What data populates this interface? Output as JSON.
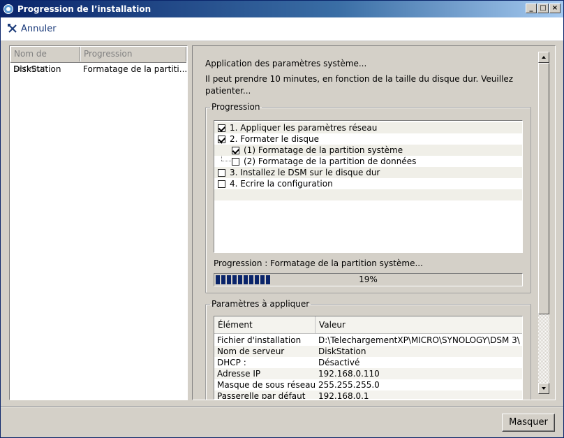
{
  "window": {
    "title": "Progression de l’installation",
    "controls": {
      "minimize": "_",
      "maximize": "□",
      "close": "×"
    }
  },
  "toolbar": {
    "cancel_label": "Annuler"
  },
  "server_list": {
    "columns": [
      "Nom de serveur",
      "Progression"
    ],
    "rows": [
      {
        "name": "DiskStation",
        "progress": "Formatage de la partiti..."
      }
    ]
  },
  "status": {
    "line1": "Application des paramètres système...",
    "line2": "Il peut prendre 10 minutes, en fonction de la taille du disque dur. Veuillez",
    "line3": "patienter..."
  },
  "progression_group": {
    "legend": "Progression",
    "steps": [
      {
        "label": "1. Appliquer les paramètres réseau",
        "checked": true
      },
      {
        "label": "2. Formater le disque",
        "checked": true
      },
      {
        "label": "(1) Formatage de la partition système",
        "checked": true
      },
      {
        "label": "(2) Formatage de la partition de données",
        "checked": false
      },
      {
        "label": "3. Installez le DSM sur le disque dur",
        "checked": false
      },
      {
        "label": "4. Ecrire la configuration",
        "checked": false
      }
    ],
    "progress_label": "Progression : Formatage de la partition système...",
    "percent_text": "19%",
    "percent_value": 19
  },
  "params_group": {
    "legend": "Paramètres à appliquer",
    "columns": [
      "Élément",
      "Valeur"
    ],
    "rows": [
      {
        "item": "Fichier d'installation",
        "value": "D:\\TelechargementXP\\MICRO\\SYNOLOGY\\DSM 3\\"
      },
      {
        "item": "Nom de serveur",
        "value": "DiskStation"
      },
      {
        "item": "DHCP :",
        "value": "Désactivé"
      },
      {
        "item": "Adresse IP",
        "value": "192.168.0.110"
      },
      {
        "item": "Masque de sous réseau",
        "value": "255.255.255.0"
      },
      {
        "item": "Passerelle par défaut",
        "value": "192.168.0.1"
      }
    ]
  },
  "footer": {
    "hide_label": "Masquer"
  },
  "colors": {
    "title_bar": "#0a246a",
    "progress": "#0a246a",
    "face": "#d4d0c8"
  }
}
